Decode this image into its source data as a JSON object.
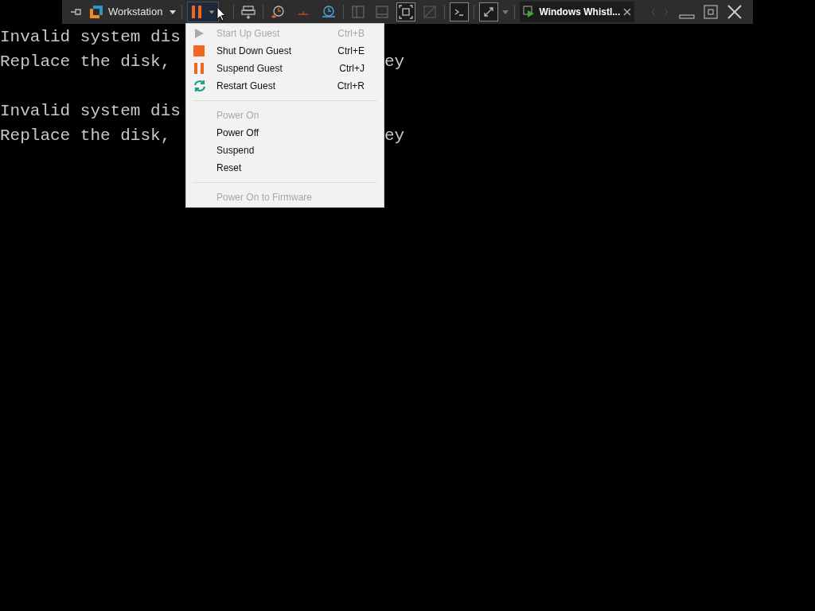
{
  "toolbar": {
    "product": "Workstation",
    "vm_tab": {
      "title": "Windows Whistl..."
    }
  },
  "console": {
    "blocks": [
      {
        "lines": [
          {
            "left": "Invalid system dis"
          },
          {
            "left": "Replace the disk,",
            "right": "ey"
          }
        ]
      },
      {
        "lines": [
          {
            "left": "Invalid system dis"
          },
          {
            "left": "Replace the disk,",
            "right": "ey"
          }
        ]
      }
    ]
  },
  "power_menu": {
    "items": [
      {
        "kind": "item",
        "label": "Start Up Guest",
        "shortcut": "Ctrl+B",
        "disabled": true
      },
      {
        "kind": "item",
        "label": "Shut Down Guest",
        "shortcut": "Ctrl+E",
        "disabled": false
      },
      {
        "kind": "item",
        "label": "Suspend Guest",
        "shortcut": "Ctrl+J",
        "disabled": false
      },
      {
        "kind": "item",
        "label": "Restart Guest",
        "shortcut": "Ctrl+R",
        "disabled": false
      },
      {
        "kind": "separator"
      },
      {
        "kind": "item",
        "label": "Power On",
        "disabled": true
      },
      {
        "kind": "item",
        "label": "Power Off",
        "disabled": false
      },
      {
        "kind": "item",
        "label": "Suspend",
        "disabled": false
      },
      {
        "kind": "item",
        "label": "Reset",
        "disabled": false
      },
      {
        "kind": "separator"
      },
      {
        "kind": "item",
        "label": "Power On to Firmware",
        "disabled": true
      }
    ]
  }
}
